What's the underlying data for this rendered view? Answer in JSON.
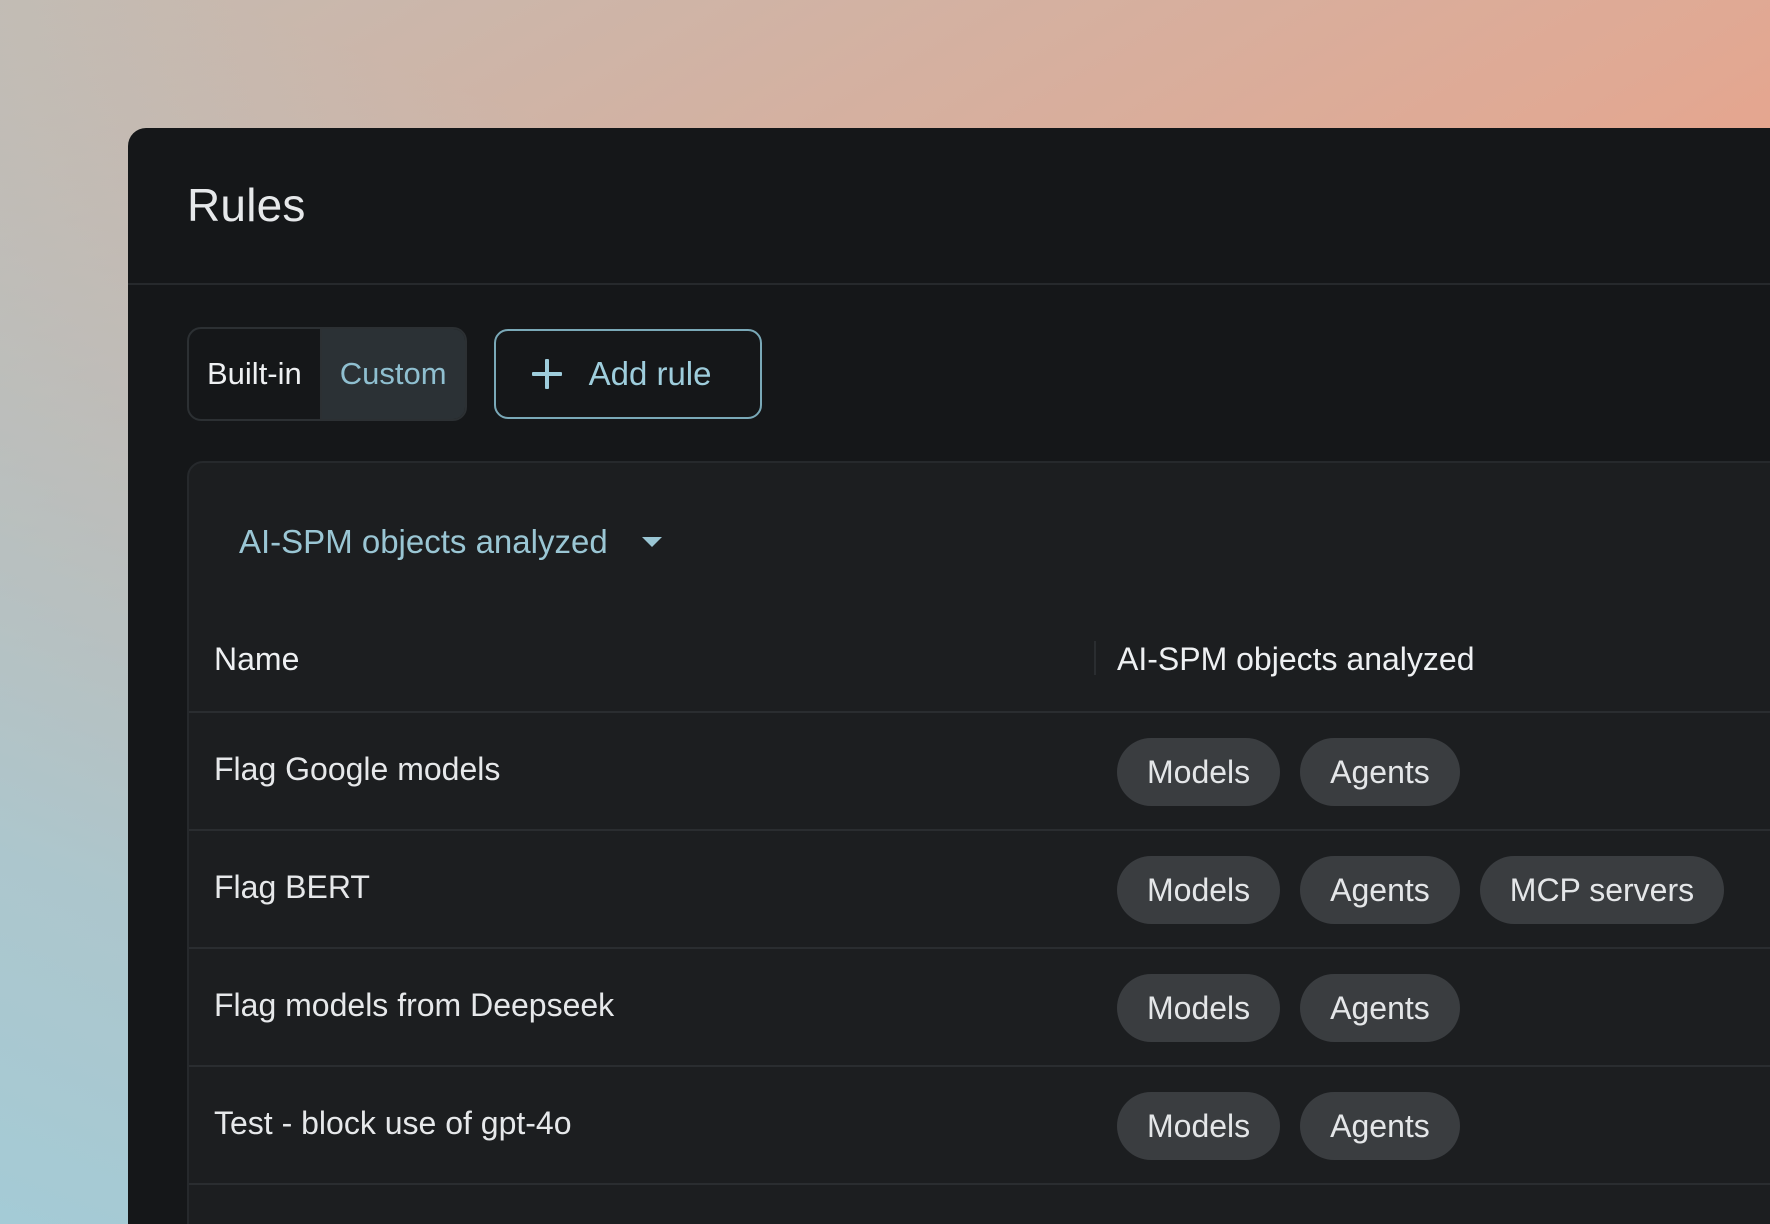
{
  "page": {
    "title": "Rules"
  },
  "toolbar": {
    "segments": [
      {
        "label": "Built-in",
        "active": false
      },
      {
        "label": "Custom",
        "active": true
      }
    ],
    "add_rule_label": "Add rule"
  },
  "filter": {
    "label": "AI-SPM objects analyzed"
  },
  "table": {
    "columns": [
      "Name",
      "AI-SPM objects analyzed"
    ],
    "rows": [
      {
        "name": "Flag Google models",
        "tags": [
          "Models",
          "Agents"
        ]
      },
      {
        "name": "Flag BERT",
        "tags": [
          "Models",
          "Agents",
          "MCP servers"
        ]
      },
      {
        "name": "Flag models from Deepseek",
        "tags": [
          "Models",
          "Agents"
        ]
      },
      {
        "name": "Test - block use of gpt-4o",
        "tags": [
          "Models",
          "Agents"
        ]
      }
    ]
  },
  "colors": {
    "window_bg": "#151719",
    "card_bg": "#1c1e20",
    "accent": "#9ecddc",
    "tag_bg": "#3a3d40"
  }
}
